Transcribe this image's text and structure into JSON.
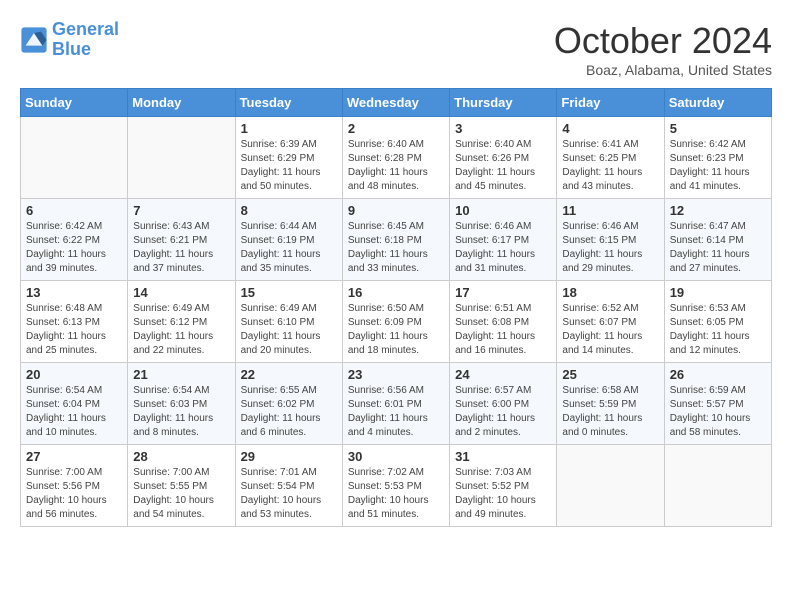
{
  "header": {
    "logo_line1": "General",
    "logo_line2": "Blue",
    "month": "October 2024",
    "location": "Boaz, Alabama, United States"
  },
  "days_of_week": [
    "Sunday",
    "Monday",
    "Tuesday",
    "Wednesday",
    "Thursday",
    "Friday",
    "Saturday"
  ],
  "weeks": [
    [
      {
        "num": "",
        "info": ""
      },
      {
        "num": "",
        "info": ""
      },
      {
        "num": "1",
        "info": "Sunrise: 6:39 AM\nSunset: 6:29 PM\nDaylight: 11 hours and 50 minutes."
      },
      {
        "num": "2",
        "info": "Sunrise: 6:40 AM\nSunset: 6:28 PM\nDaylight: 11 hours and 48 minutes."
      },
      {
        "num": "3",
        "info": "Sunrise: 6:40 AM\nSunset: 6:26 PM\nDaylight: 11 hours and 45 minutes."
      },
      {
        "num": "4",
        "info": "Sunrise: 6:41 AM\nSunset: 6:25 PM\nDaylight: 11 hours and 43 minutes."
      },
      {
        "num": "5",
        "info": "Sunrise: 6:42 AM\nSunset: 6:23 PM\nDaylight: 11 hours and 41 minutes."
      }
    ],
    [
      {
        "num": "6",
        "info": "Sunrise: 6:42 AM\nSunset: 6:22 PM\nDaylight: 11 hours and 39 minutes."
      },
      {
        "num": "7",
        "info": "Sunrise: 6:43 AM\nSunset: 6:21 PM\nDaylight: 11 hours and 37 minutes."
      },
      {
        "num": "8",
        "info": "Sunrise: 6:44 AM\nSunset: 6:19 PM\nDaylight: 11 hours and 35 minutes."
      },
      {
        "num": "9",
        "info": "Sunrise: 6:45 AM\nSunset: 6:18 PM\nDaylight: 11 hours and 33 minutes."
      },
      {
        "num": "10",
        "info": "Sunrise: 6:46 AM\nSunset: 6:17 PM\nDaylight: 11 hours and 31 minutes."
      },
      {
        "num": "11",
        "info": "Sunrise: 6:46 AM\nSunset: 6:15 PM\nDaylight: 11 hours and 29 minutes."
      },
      {
        "num": "12",
        "info": "Sunrise: 6:47 AM\nSunset: 6:14 PM\nDaylight: 11 hours and 27 minutes."
      }
    ],
    [
      {
        "num": "13",
        "info": "Sunrise: 6:48 AM\nSunset: 6:13 PM\nDaylight: 11 hours and 25 minutes."
      },
      {
        "num": "14",
        "info": "Sunrise: 6:49 AM\nSunset: 6:12 PM\nDaylight: 11 hours and 22 minutes."
      },
      {
        "num": "15",
        "info": "Sunrise: 6:49 AM\nSunset: 6:10 PM\nDaylight: 11 hours and 20 minutes."
      },
      {
        "num": "16",
        "info": "Sunrise: 6:50 AM\nSunset: 6:09 PM\nDaylight: 11 hours and 18 minutes."
      },
      {
        "num": "17",
        "info": "Sunrise: 6:51 AM\nSunset: 6:08 PM\nDaylight: 11 hours and 16 minutes."
      },
      {
        "num": "18",
        "info": "Sunrise: 6:52 AM\nSunset: 6:07 PM\nDaylight: 11 hours and 14 minutes."
      },
      {
        "num": "19",
        "info": "Sunrise: 6:53 AM\nSunset: 6:05 PM\nDaylight: 11 hours and 12 minutes."
      }
    ],
    [
      {
        "num": "20",
        "info": "Sunrise: 6:54 AM\nSunset: 6:04 PM\nDaylight: 11 hours and 10 minutes."
      },
      {
        "num": "21",
        "info": "Sunrise: 6:54 AM\nSunset: 6:03 PM\nDaylight: 11 hours and 8 minutes."
      },
      {
        "num": "22",
        "info": "Sunrise: 6:55 AM\nSunset: 6:02 PM\nDaylight: 11 hours and 6 minutes."
      },
      {
        "num": "23",
        "info": "Sunrise: 6:56 AM\nSunset: 6:01 PM\nDaylight: 11 hours and 4 minutes."
      },
      {
        "num": "24",
        "info": "Sunrise: 6:57 AM\nSunset: 6:00 PM\nDaylight: 11 hours and 2 minutes."
      },
      {
        "num": "25",
        "info": "Sunrise: 6:58 AM\nSunset: 5:59 PM\nDaylight: 11 hours and 0 minutes."
      },
      {
        "num": "26",
        "info": "Sunrise: 6:59 AM\nSunset: 5:57 PM\nDaylight: 10 hours and 58 minutes."
      }
    ],
    [
      {
        "num": "27",
        "info": "Sunrise: 7:00 AM\nSunset: 5:56 PM\nDaylight: 10 hours and 56 minutes."
      },
      {
        "num": "28",
        "info": "Sunrise: 7:00 AM\nSunset: 5:55 PM\nDaylight: 10 hours and 54 minutes."
      },
      {
        "num": "29",
        "info": "Sunrise: 7:01 AM\nSunset: 5:54 PM\nDaylight: 10 hours and 53 minutes."
      },
      {
        "num": "30",
        "info": "Sunrise: 7:02 AM\nSunset: 5:53 PM\nDaylight: 10 hours and 51 minutes."
      },
      {
        "num": "31",
        "info": "Sunrise: 7:03 AM\nSunset: 5:52 PM\nDaylight: 10 hours and 49 minutes."
      },
      {
        "num": "",
        "info": ""
      },
      {
        "num": "",
        "info": ""
      }
    ]
  ]
}
